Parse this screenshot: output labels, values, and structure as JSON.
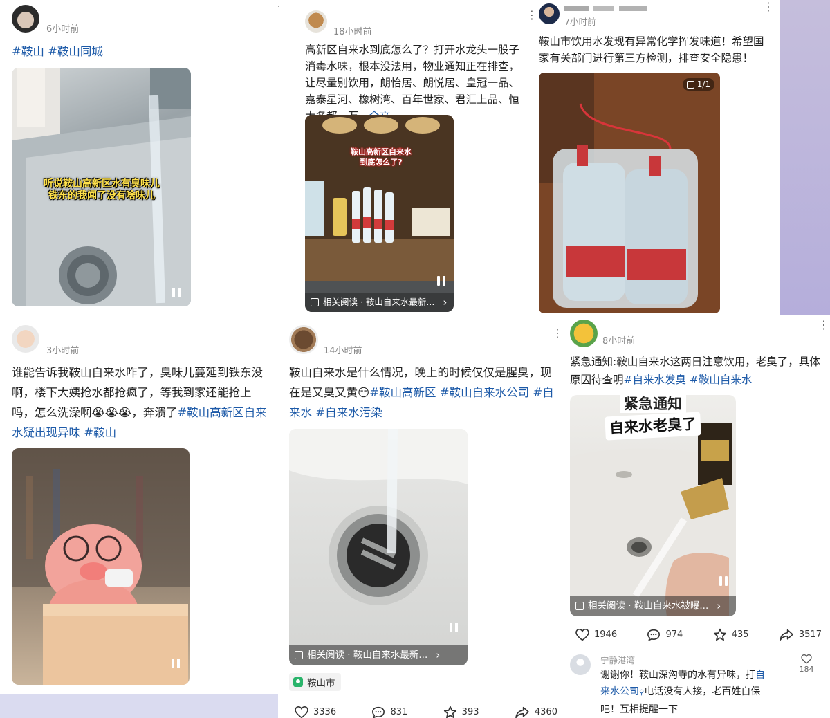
{
  "posts": [
    {
      "time": "6小时前",
      "text_parts": [
        {
          "t": "#鞍山 #鞍山同城",
          "tag": true
        }
      ],
      "overlay": [
        "听说鞍山高新区水有臭味儿",
        "铁东的我闻了没有啥味儿"
      ]
    },
    {
      "time": "18小时前",
      "text_parts": [
        {
          "t": "高新区自来水到底怎么了？打开水龙头一股子消毒水味，根本没法用，物业通知正在排查，让尽量别饮用，朗怡居、朗悦居、皇冠一品、嘉泰星河、橡树湾、百年世家、君汇上品、恒大名都、万...",
          "tag": false
        },
        {
          "t": "全文",
          "tag": true
        }
      ],
      "overlay": [
        "鞍山高新区自来水",
        "到底怎么了?"
      ],
      "related": "相关阅读 · 鞍山自来水最新..."
    },
    {
      "time": "7小时前",
      "text_parts": [
        {
          "t": "鞍山市饮用水发现有异常化学挥发味道！希望国家有关部门进行第三方检测，排查安全隐患！",
          "tag": false
        }
      ],
      "badge": "1/1"
    },
    {
      "time": "3小时前",
      "text_parts": [
        {
          "t": "谁能告诉我鞍山自来水咋了，臭味儿蔓延到铁东没啊，楼下大姨抢水都抢疯了，等我到家还能抢上吗，怎么洗澡啊😭😭😭，奔溃了",
          "tag": false
        },
        {
          "t": "#鞍山高新区自来水疑出现异味 #鞍山",
          "tag": true
        }
      ]
    },
    {
      "time": "14小时前",
      "text_parts": [
        {
          "t": "鞍山自来水是什么情况，晚上的时候仅仅是腥臭，现在是又臭又黄😑",
          "tag": false
        },
        {
          "t": "#鞍山高新区 #鞍山自来水公司 #自来水 #自来水污染",
          "tag": true
        }
      ],
      "related": "相关阅读 · 鞍山自来水最新...",
      "location": "鞍山市",
      "actions": {
        "likes": "3336",
        "comments": "831",
        "favorites": "393",
        "shares": "4360"
      }
    },
    {
      "time": "8小时前",
      "text_parts": [
        {
          "t": "紧急通知:鞍山自来水这两日注意饮用，老臭了，具体原因待查明",
          "tag": false
        },
        {
          "t": "#自来水发臭 #鞍山自来水",
          "tag": true
        }
      ],
      "overlay": [
        "紧急通知",
        "自来水老臭了"
      ],
      "related": "相关阅读 · 鞍山自来水被曝...",
      "actions": {
        "likes": "1946",
        "comments": "974",
        "favorites": "435",
        "shares": "3517"
      },
      "comment": {
        "user": "宁静港湾",
        "text_before": "谢谢你！鞍山深沟寺的水有异味，打",
        "link": "自来水公司",
        "text_after": "电话没有人接，老百姓自保吧！互相提醒一下",
        "likes": "184"
      }
    }
  ],
  "colors": {
    "tag": "#1d5aa8",
    "time": "#888888",
    "pin": "#2ab46b"
  },
  "icons": [
    "more-icon",
    "pause-icon",
    "document-icon",
    "chevron-right-icon",
    "heart-icon",
    "comment-icon",
    "star-icon",
    "share-icon",
    "location-icon",
    "search-icon",
    "gallery-icon"
  ]
}
